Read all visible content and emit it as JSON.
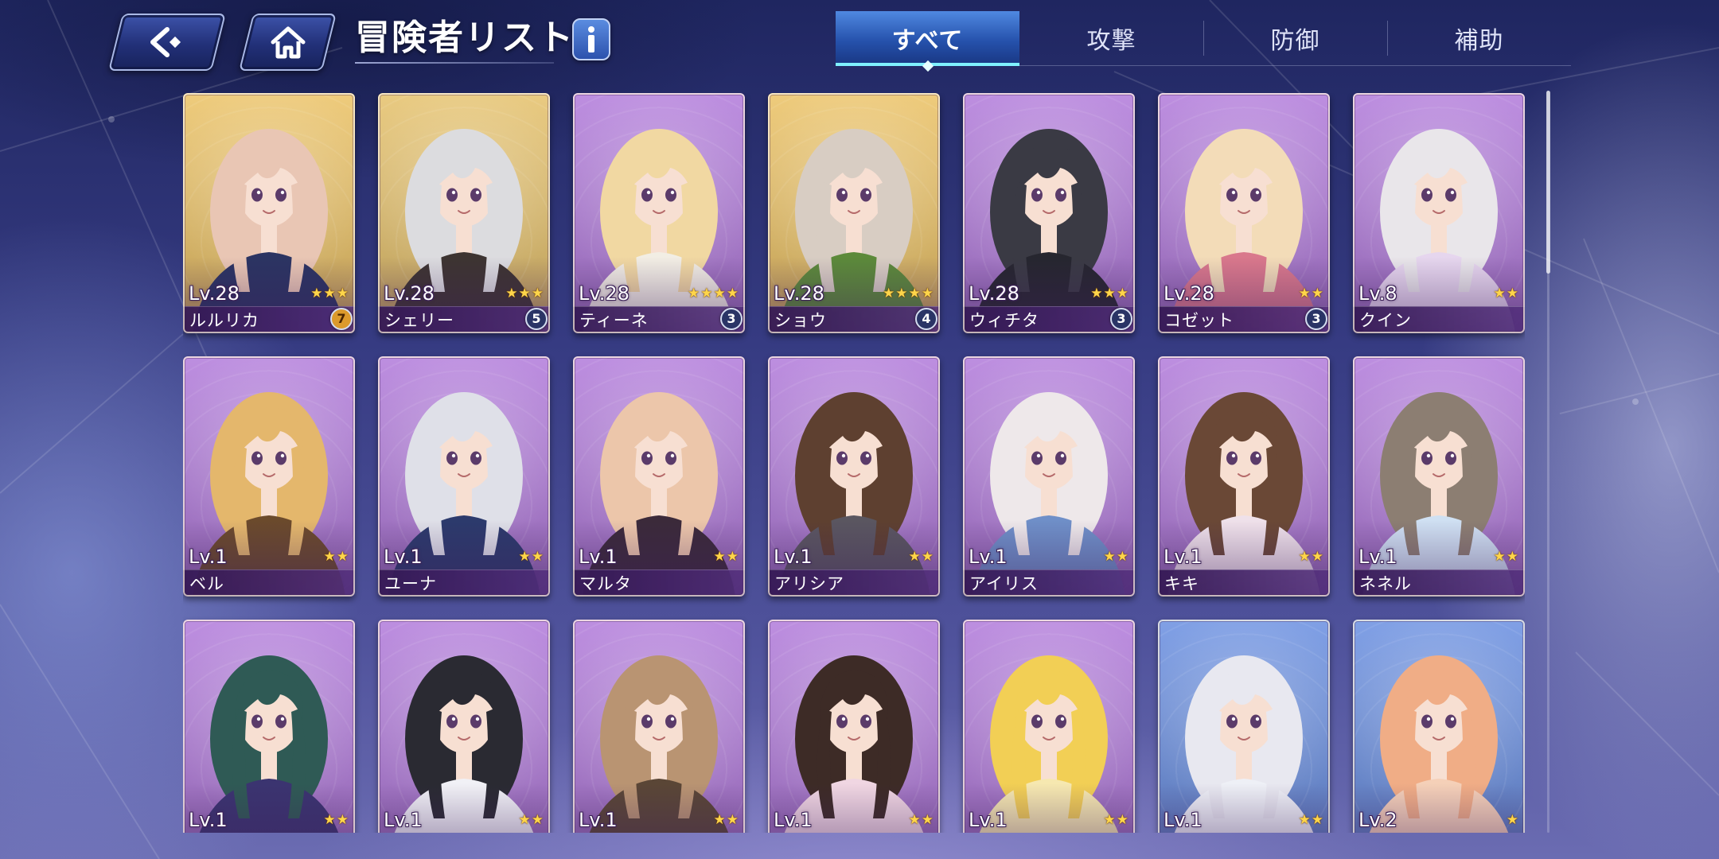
{
  "header": {
    "back_icon": "back-arrow-icon",
    "home_icon": "home-icon",
    "title": "冒険者リスト",
    "info_icon": "info-icon"
  },
  "tabs": [
    {
      "label": "すべて",
      "selected": true
    },
    {
      "label": "攻撃",
      "selected": false
    },
    {
      "label": "防御",
      "selected": false
    },
    {
      "label": "補助",
      "selected": false
    }
  ],
  "colors": {
    "skin": "#f7dfd2",
    "star": "#ffd54a",
    "tab_underline": "#7ff0ff",
    "card_gold": "#ecc46a",
    "card_purple": "#b47fdc",
    "card_blue": "#6f93e2"
  },
  "adventurers": [
    {
      "level": "Lv.28",
      "name": "ルルリカ",
      "stars": 3,
      "rank": "7",
      "rank_color": "#dc9a2c",
      "rank_text_color": "#4a2500",
      "card_color": "#ecc46a",
      "hair": "#e9c6b4",
      "outfit": "#2b3462"
    },
    {
      "level": "Lv.28",
      "name": "シェリー",
      "stars": 3,
      "rank": "5",
      "rank_color": "#2a3466",
      "rank_text_color": "#ffffff",
      "card_color": "#e6c370",
      "hair": "#dcdcdf",
      "outfit": "#3d3431"
    },
    {
      "level": "Lv.28",
      "name": "ティーネ",
      "stars": 4,
      "rank": "3",
      "rank_color": "#2a3466",
      "rank_text_color": "#ffffff",
      "card_color": "#b47fdc",
      "hair": "#f1d8a2",
      "outfit": "#f2eee4"
    },
    {
      "level": "Lv.28",
      "name": "ショウ",
      "stars": 4,
      "rank": "4",
      "rank_color": "#2a3466",
      "rank_text_color": "#ffffff",
      "card_color": "#ecc46a",
      "hair": "#d8cdc3",
      "outfit": "#5c8a3a"
    },
    {
      "level": "Lv.28",
      "name": "ウィチタ",
      "stars": 3,
      "rank": "3",
      "rank_color": "#2a3466",
      "rank_text_color": "#ffffff",
      "card_color": "#b47fdc",
      "hair": "#3a3a44",
      "outfit": "#26262f"
    },
    {
      "level": "Lv.28",
      "name": "コゼット",
      "stars": 2,
      "rank": "3",
      "rank_color": "#2a3466",
      "rank_text_color": "#ffffff",
      "card_color": "#b47fdc",
      "hair": "#f3dcb8",
      "outfit": "#d9788c"
    },
    {
      "level": "Lv.8",
      "name": "クイン",
      "stars": 2,
      "card_color": "#b47fdc",
      "hair": "#e9e6ea",
      "outfit": "#e6d6ee"
    },
    {
      "level": "Lv.1",
      "name": "ベル",
      "stars": 2,
      "card_color": "#b47fdc",
      "hair": "#e4b76c",
      "outfit": "#6b4a2c"
    },
    {
      "level": "Lv.1",
      "name": "ユーナ",
      "stars": 2,
      "card_color": "#b47fdc",
      "hair": "#dfe0e8",
      "outfit": "#2c3a6c"
    },
    {
      "level": "Lv.1",
      "name": "マルタ",
      "stars": 2,
      "card_color": "#b47fdc",
      "hair": "#ecc6aa",
      "outfit": "#3b2a3a"
    },
    {
      "level": "Lv.1",
      "name": "アリシア",
      "stars": 2,
      "card_color": "#b47fdc",
      "hair": "#5e4030",
      "outfit": "#5a5660"
    },
    {
      "level": "Lv.1",
      "name": "アイリス",
      "stars": 2,
      "card_color": "#b47fdc",
      "hair": "#eee8ea",
      "outfit": "#6f8fc8"
    },
    {
      "level": "Lv.1",
      "name": "キキ",
      "stars": 2,
      "card_color": "#b47fdc",
      "hair": "#6a4836",
      "outfit": "#efe1ea"
    },
    {
      "level": "Lv.1",
      "name": "ネネル",
      "stars": 2,
      "card_color": "#b47fdc",
      "hair": "#8c7e72",
      "outfit": "#cfe0f2"
    },
    {
      "level": "Lv.1",
      "stars": 2,
      "card_color": "#b47fdc",
      "hair": "#2f5a55",
      "outfit": "#3b3470"
    },
    {
      "level": "Lv.1",
      "stars": 2,
      "card_color": "#b47fdc",
      "hair": "#2a2a32",
      "outfit": "#f1f1f6"
    },
    {
      "level": "Lv.1",
      "stars": 2,
      "card_color": "#b47fdc",
      "hair": "#b99472",
      "outfit": "#5a4636"
    },
    {
      "level": "Lv.1",
      "stars": 2,
      "card_color": "#b47fdc",
      "hair": "#3d2b26",
      "outfit": "#f0d6e2"
    },
    {
      "level": "Lv.1",
      "stars": 2,
      "card_color": "#b47fdc",
      "hair": "#f2cf55",
      "outfit": "#f6e8b0"
    },
    {
      "level": "Lv.1",
      "stars": 2,
      "card_color": "#6f93e2",
      "hair": "#e8e8f0",
      "outfit": "#eef0f6"
    },
    {
      "level": "Lv.2",
      "stars": 1,
      "card_color": "#6f93e2",
      "hair": "#f0ad86",
      "outfit": "#f5d0b8"
    }
  ]
}
